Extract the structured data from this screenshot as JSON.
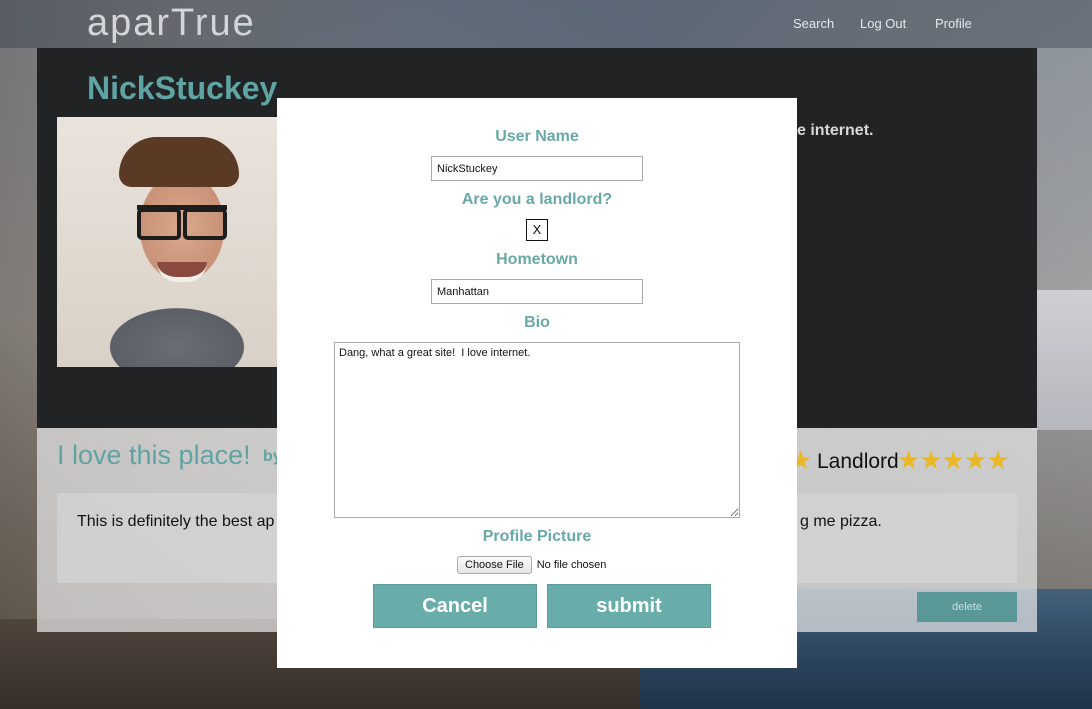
{
  "header": {
    "logo": "aparTrue",
    "nav": {
      "search": "Search",
      "logout": "Log Out",
      "profile": "Profile"
    }
  },
  "profile": {
    "name": "NickStuckey",
    "bio_peek": "e internet."
  },
  "review": {
    "title": "I love this place!",
    "by_peek": "by",
    "star_peek": "★",
    "landlord_label": "Landlord",
    "landlord_stars": "★★★★★",
    "text_left": "This is definitely the best ap",
    "text_right": "g me pizza.",
    "delete_label": "delete"
  },
  "modal": {
    "username_label": "User Name",
    "username_value": "NickStuckey",
    "landlord_question": "Are you a landlord?",
    "landlord_check": "X",
    "hometown_label": "Hometown",
    "hometown_value": "Manhattan",
    "bio_label": "Bio",
    "bio_value": "Dang, what a great site!  I love internet.",
    "picture_label": "Profile Picture",
    "choose_file": "Choose File",
    "file_status": "No file chosen",
    "cancel_label": "Cancel",
    "submit_label": "submit"
  },
  "colors": {
    "accent": "#69adab",
    "star": "#e9b824",
    "panel_dark": "#222325"
  }
}
